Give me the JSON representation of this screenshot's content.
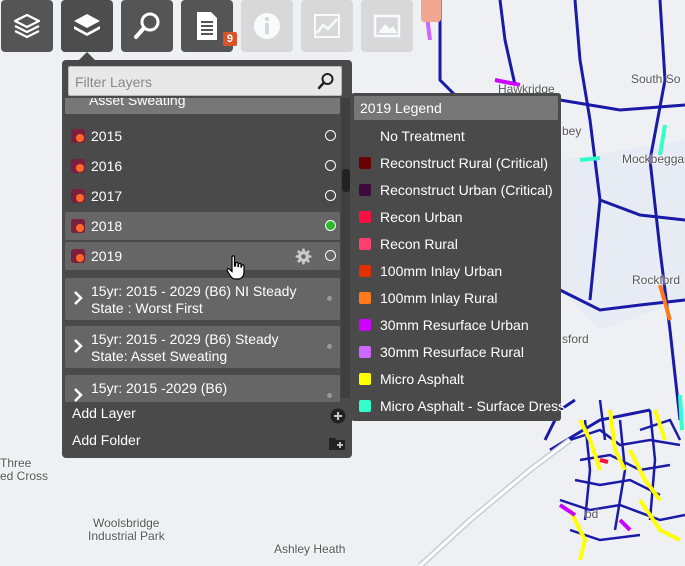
{
  "toolbar": {
    "buttons": [
      {
        "name": "layers-icon",
        "state": "normal"
      },
      {
        "name": "layers-icon",
        "state": "active"
      },
      {
        "name": "search-icon",
        "state": "normal"
      },
      {
        "name": "document-icon",
        "state": "normal",
        "badge": "9"
      },
      {
        "name": "info-icon",
        "state": "disabled"
      },
      {
        "name": "chart-icon",
        "state": "disabled"
      },
      {
        "name": "image-icon",
        "state": "disabled"
      }
    ]
  },
  "filter": {
    "placeholder": "Filter Layers"
  },
  "layers": {
    "partial_top": "Asset Sweating",
    "items": [
      {
        "label": "2015",
        "active": false
      },
      {
        "label": "2016",
        "active": false
      },
      {
        "label": "2017",
        "active": false
      },
      {
        "label": "2018",
        "active": true
      },
      {
        "label": "2019",
        "active": false
      }
    ],
    "groups": [
      {
        "line1": "15yr: 2015 - 2029 (B6) NI Steady",
        "line2": "State : Worst First"
      },
      {
        "line1": "15yr: 2015 - 2029 (B6) Steady",
        "line2": "State: Asset Sweating"
      },
      {
        "line1": "15yr: 2015 -2029 (B6)",
        "line2": ""
      }
    ],
    "add_layer": "Add Layer",
    "add_folder": "Add Folder"
  },
  "legend": {
    "title": "2019 Legend",
    "entries": [
      {
        "label": "No Treatment",
        "color": ""
      },
      {
        "label": "Reconstruct Rural (Critical)",
        "color": "#6b0000"
      },
      {
        "label": "Reconstruct Urban (Critical)",
        "color": "#3d0a3d"
      },
      {
        "label": "Recon Urban",
        "color": "#ff1040"
      },
      {
        "label": "Recon Rural",
        "color": "#ff3f6f"
      },
      {
        "label": "100mm Inlay Urban",
        "color": "#e03000"
      },
      {
        "label": "100mm Inlay Rural",
        "color": "#ff7a1a"
      },
      {
        "label": "30mm Resurface Urban",
        "color": "#cc00ff"
      },
      {
        "label": "30mm Resurface Rural",
        "color": "#cc66ff"
      },
      {
        "label": "Micro Asphalt",
        "color": "#ffff00"
      },
      {
        "label": "Micro Asphalt - Surface Dress",
        "color": "#33ffcc"
      }
    ]
  },
  "map": {
    "places": [
      {
        "text": "South So"
      },
      {
        "text": "Hawkridge"
      },
      {
        "text": "Mockbeggar"
      },
      {
        "text": "Rockford"
      },
      {
        "text": "Three"
      },
      {
        "text": "ed Cross"
      },
      {
        "text": "Woolsbridge"
      },
      {
        "text": "Industrial Park"
      },
      {
        "text": "Ashley Heath"
      },
      {
        "text": "bey"
      },
      {
        "text": "sford"
      },
      {
        "text": "od"
      }
    ]
  }
}
